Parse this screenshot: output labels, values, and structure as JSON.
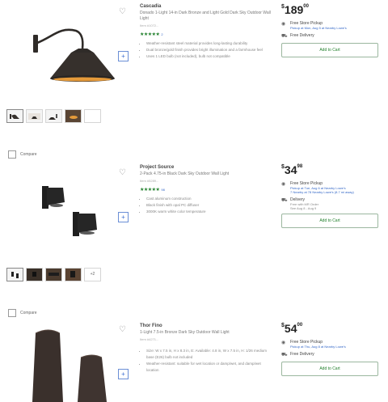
{
  "products": [
    {
      "brand": "Cascadia",
      "title": "Donado 1-Light 14-in Dark Bronze and Light Gold Dark Sky Outdoor Wall Light",
      "model": "Item #1072...",
      "rating_count": "2",
      "features": [
        "Weather-resistant steel material provides long-lasting durability",
        "Dual bronze/gold finish provides bright illumination and a farmhouse feel",
        "Uses 1 LED bulb (not included), bulb not compatible"
      ],
      "price_dollars": "189",
      "price_cents": "00",
      "pickup_title": "Free Store Pickup",
      "pickup_sub": "Pickup at Mon, Aug 5 at Nearby Lowe's",
      "delivery_title": "Free Delivery",
      "delivery_sub": "",
      "delivery_sub2": "",
      "add_to_cart": "Add to Cart",
      "compare_label": "",
      "thumbs_more": ""
    },
    {
      "brand": "Project Source",
      "title": "2-Pack 4.75-in Black Dark Sky Outdoor Wall Light",
      "model": "Item #5289...",
      "rating_count": "98",
      "features": [
        "Cast aluminum construction",
        "Black finish with opal PC diffuser",
        "3000K warm white color temperature"
      ],
      "price_dollars": "34",
      "price_cents": "98",
      "pickup_title": "Free Store Pickup",
      "pickup_sub": "Pickup at Tue, Aug 6 at Nearby Lowe's",
      "pickup_sub2": "7 Nearby at 78 Nearby Lowe's (8.7 mi away)",
      "delivery_title": "Delivery",
      "delivery_sub": "Free with MR Order",
      "delivery_sub2": "See Aug 8 - Aug 9",
      "add_to_cart": "Add to Cart",
      "compare_label": "Compare",
      "thumbs_more": "+2"
    },
    {
      "brand": "Thor Fino",
      "title": "1-Light 7.5-in Bronze Dark Sky Outdoor Wall Light",
      "model": "Item #4271...",
      "rating_count": "",
      "features": [
        "Size: W x 7.5 in, H x 8.3 in, E: Available: 4.8 in, W x 7.5 in, H: 1/26 medium base (E26) bulb not included",
        "Weather-resistant: suitable for wet location or damp/wet, and damp/wet location"
      ],
      "price_dollars": "54",
      "price_cents": "00",
      "pickup_title": "Free Store Pickup",
      "pickup_sub": "Pickup at Thu, Aug 8 at Nearby Lowe's",
      "delivery_title": "Free Delivery",
      "delivery_sub": "",
      "delivery_sub2": "",
      "add_to_cart": "Add to Cart",
      "compare_label": "Compare",
      "thumbs_more": ""
    }
  ],
  "icons": {
    "heart": "heart-outline-icon",
    "add": "plus-icon",
    "pickup": "store-icon",
    "delivery": "truck-icon"
  },
  "colors": {
    "accent_green": "#1f7f2a",
    "link_blue": "#3367c7",
    "lamp_dark": "#2f2b28",
    "lamp_glow": "#e59a3a"
  }
}
